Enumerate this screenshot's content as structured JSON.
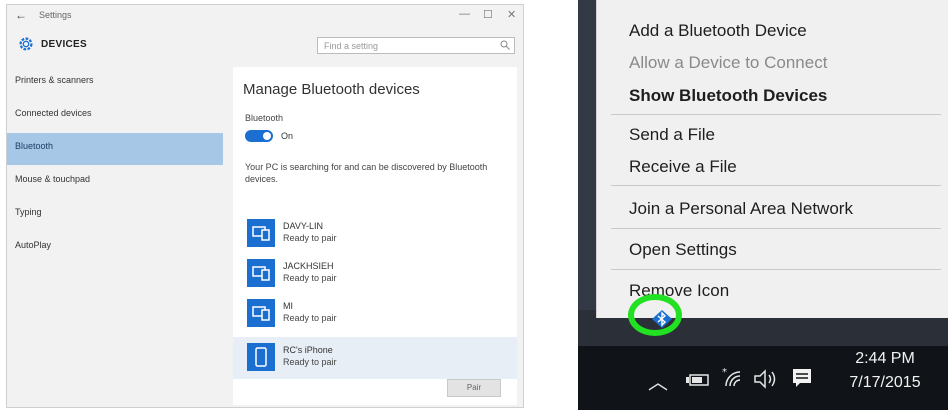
{
  "settings": {
    "title": "Settings",
    "header": "DEVICES",
    "search_placeholder": "Find a setting",
    "nav": [
      "Printers & scanners",
      "Connected devices",
      "Bluetooth",
      "Mouse & touchpad",
      "Typing",
      "AutoPlay"
    ],
    "selected_nav": "Bluetooth",
    "panel": {
      "title": "Manage Bluetooth devices",
      "bluetooth_label": "Bluetooth",
      "toggle_state": "On",
      "description": "Your PC is searching for and can be discovered by Bluetooth devices.",
      "devices": [
        {
          "name": "DAVY-LIN",
          "status": "Ready to pair"
        },
        {
          "name": "JACKHSIEH",
          "status": "Ready to pair"
        },
        {
          "name": "MI",
          "status": "Ready to pair"
        },
        {
          "name": "RC's iPhone",
          "status": "Ready to pair"
        }
      ],
      "pair_button": "Pair"
    }
  },
  "context_menu": {
    "items": [
      {
        "label": "Add a Bluetooth Device",
        "state": "normal"
      },
      {
        "label": "Allow a Device to Connect",
        "state": "disabled"
      },
      {
        "label": "Show Bluetooth Devices",
        "state": "bold"
      },
      {
        "label": "Send a File",
        "state": "normal"
      },
      {
        "label": "Receive a File",
        "state": "normal"
      },
      {
        "label": "Join a Personal Area Network",
        "state": "normal"
      },
      {
        "label": "Open Settings",
        "state": "normal"
      },
      {
        "label": "Remove Icon",
        "state": "normal"
      }
    ]
  },
  "taskbar": {
    "time": "2:44 PM",
    "date": "7/17/2015",
    "icons": [
      "chevron-up-icon",
      "battery-icon",
      "wifi-icon",
      "volume-icon",
      "action-center-icon"
    ]
  },
  "colors": {
    "accent": "#1a6fd1",
    "selected_nav": "#a7c7e7",
    "highlight_ring": "#22e022"
  }
}
